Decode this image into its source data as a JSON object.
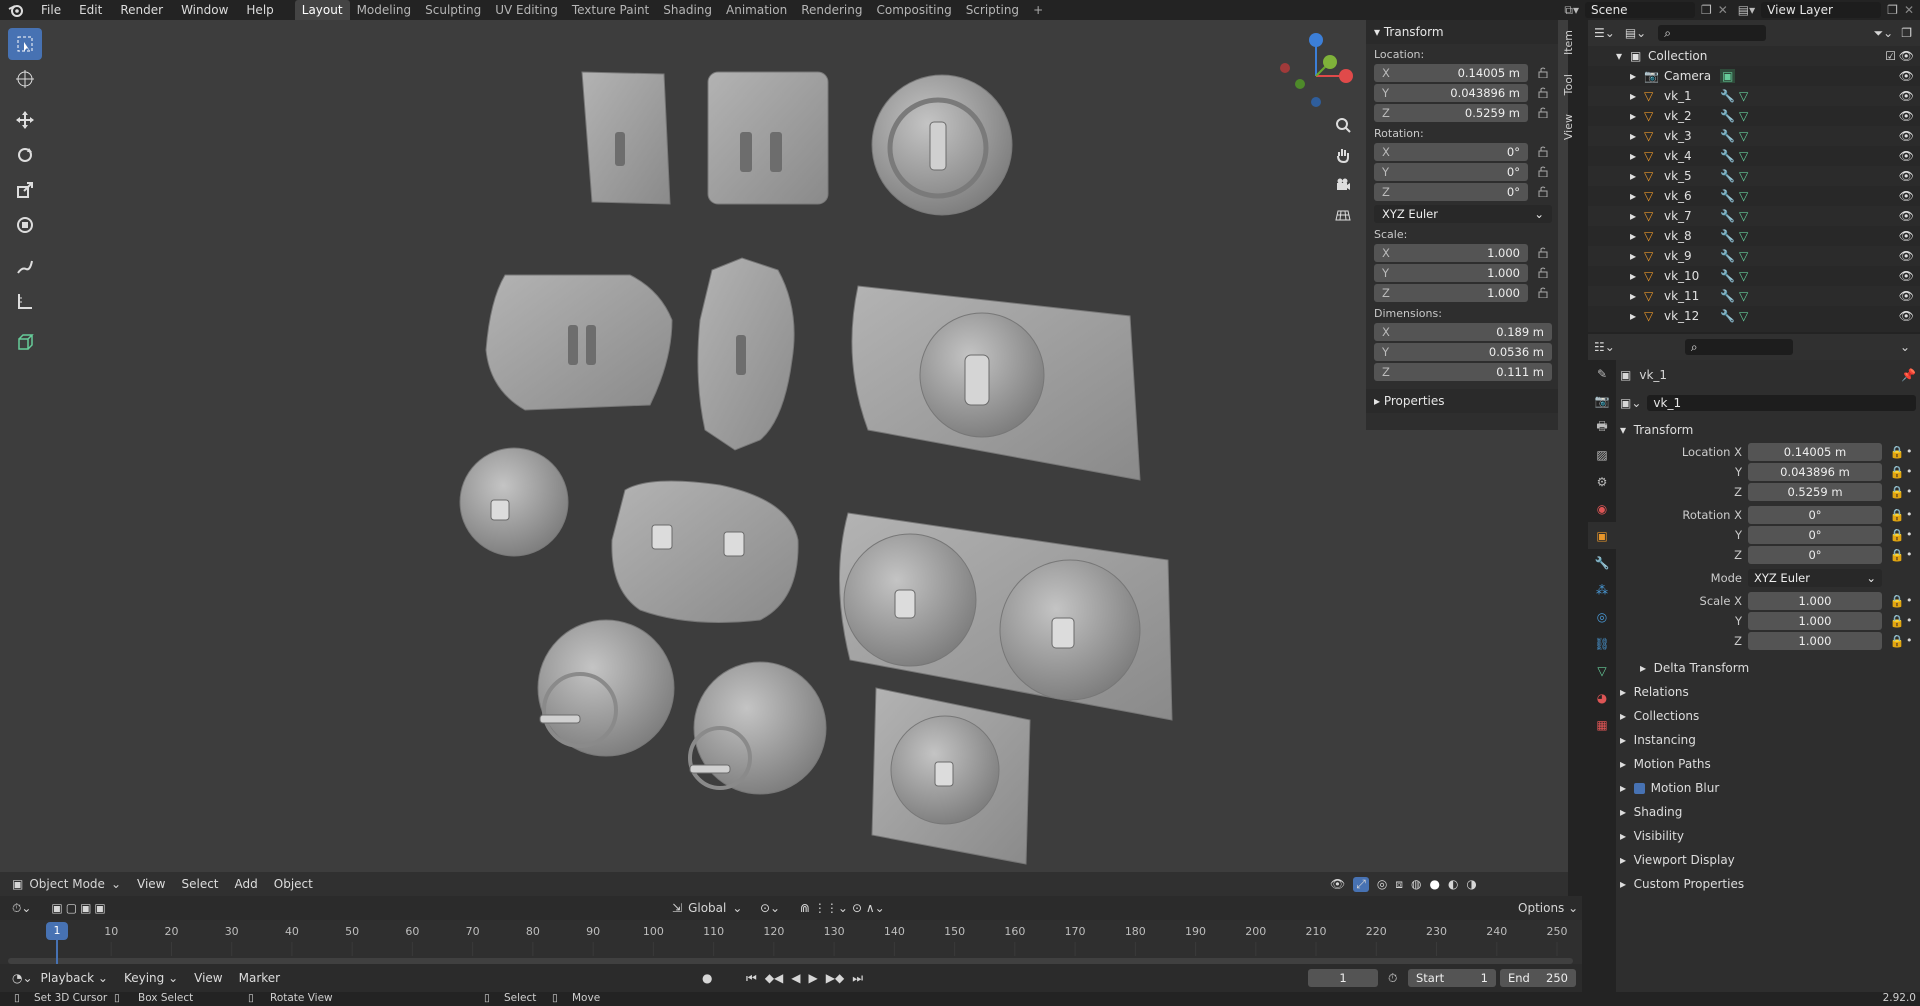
{
  "menu": [
    "File",
    "Edit",
    "Render",
    "Window",
    "Help"
  ],
  "workspaces": [
    "Layout",
    "Modeling",
    "Sculpting",
    "UV Editing",
    "Texture Paint",
    "Shading",
    "Animation",
    "Rendering",
    "Compositing",
    "Scripting"
  ],
  "active_workspace": "Layout",
  "scene": "Scene",
  "view_layer": "View Layer",
  "npanel": {
    "tabs": [
      "Item",
      "Tool",
      "View"
    ],
    "transform_title": "Transform",
    "location_label": "Location:",
    "location": {
      "x": "0.14005 m",
      "y": "0.043896 m",
      "z": "0.5259 m"
    },
    "rotation_label": "Rotation:",
    "rotation": {
      "x": "0°",
      "y": "0°",
      "z": "0°"
    },
    "rotation_mode": "XYZ Euler",
    "scale_label": "Scale:",
    "scale": {
      "x": "1.000",
      "y": "1.000",
      "z": "1.000"
    },
    "dimensions_label": "Dimensions:",
    "dimensions": {
      "x": "0.189 m",
      "y": "0.0536 m",
      "z": "0.111 m"
    },
    "properties_label": "Properties",
    "axis": {
      "x": "X",
      "y": "Y",
      "z": "Z"
    }
  },
  "viewport_header": {
    "mode": "Object Mode",
    "menus": [
      "View",
      "Select",
      "Add",
      "Object"
    ]
  },
  "tool_header": {
    "orientation": "Global",
    "options": "Options"
  },
  "timeline": {
    "menus": [
      "Playback",
      "Keying",
      "View",
      "Marker"
    ],
    "current_frame": "1",
    "start_label": "Start",
    "start": "1",
    "end_label": "End",
    "end": "250",
    "ticks": [
      "1",
      "10",
      "20",
      "30",
      "40",
      "50",
      "60",
      "70",
      "80",
      "90",
      "100",
      "110",
      "120",
      "130",
      "140",
      "150",
      "160",
      "170",
      "180",
      "190",
      "200",
      "210",
      "220",
      "230",
      "240",
      "250"
    ]
  },
  "status": {
    "items": [
      "Set 3D Cursor",
      "Box Select",
      "Rotate View",
      "Select",
      "Move"
    ],
    "version": "2.92.0"
  },
  "outliner": {
    "collection": "Collection",
    "items": [
      "Camera",
      "vk_1",
      "vk_2",
      "vk_3",
      "vk_4",
      "vk_5",
      "vk_6",
      "vk_7",
      "vk_8",
      "vk_9",
      "vk_10",
      "vk_11",
      "vk_12"
    ]
  },
  "properties": {
    "object_name": "vk_1",
    "transform_title": "Transform",
    "labels": {
      "locx": "Location X",
      "y": "Y",
      "z": "Z",
      "rotx": "Rotation X",
      "mode": "Mode",
      "scalex": "Scale X"
    },
    "location": {
      "x": "0.14005 m",
      "y": "0.043896 m",
      "z": "0.5259 m"
    },
    "rotation": {
      "x": "0°",
      "y": "0°",
      "z": "0°"
    },
    "mode": "XYZ Euler",
    "scale": {
      "x": "1.000",
      "y": "1.000",
      "z": "1.000"
    },
    "sections": [
      "Delta Transform",
      "Relations",
      "Collections",
      "Instancing",
      "Motion Paths",
      "Motion Blur",
      "Shading",
      "Visibility",
      "Viewport Display",
      "Custom Properties"
    ]
  },
  "colors": {
    "accent": "#4772b3",
    "viewport_bg": "#3d3d3d",
    "mesh": "#a8a8a8",
    "object_orange": "#e8962a"
  }
}
